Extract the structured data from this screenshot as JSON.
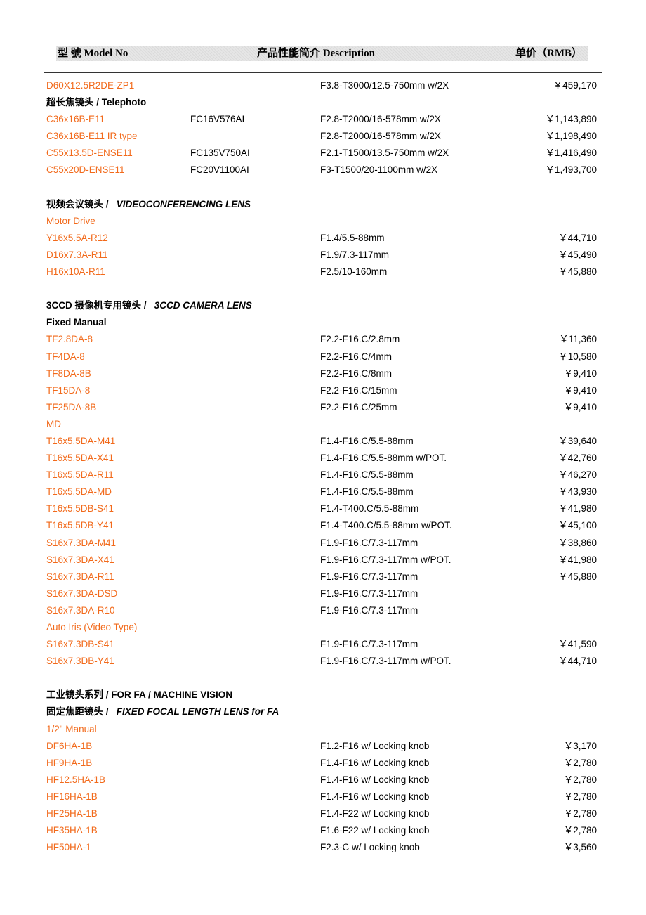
{
  "header": {
    "model_label": "型   號 Model No",
    "desc_label": "产品性能简介 Description",
    "price_label": "单价（RMB）"
  },
  "colors": {
    "model_text": "#f26a1b",
    "body_text": "#000000"
  },
  "rows": [
    {
      "type": "item",
      "model": "D60X12.5R2DE-ZP1",
      "alt": "",
      "desc": "F3.8-T3000/12.5-750mm w/2X",
      "price": "￥459,170"
    },
    {
      "type": "section",
      "cn": "超长焦镜头",
      "en": "/ Telephoto",
      "en_italic": false
    },
    {
      "type": "item",
      "model": "C36x16B-E11",
      "alt": "FC16V576AI",
      "desc": "F2.8-T2000/16-578mm w/2X",
      "price": "￥1,143,890"
    },
    {
      "type": "item",
      "model": "C36x16B-E11 IR type",
      "alt": "",
      "desc": "F2.8-T2000/16-578mm w/2X",
      "price": "￥1,198,490"
    },
    {
      "type": "item",
      "model": "C55x13.5D-ENSE11",
      "alt": "FC135V750AI",
      "desc": "F2.1-T1500/13.5-750mm w/2X",
      "price": "￥1,416,490"
    },
    {
      "type": "item",
      "model": "C55x20D-ENSE11",
      "alt": "FC20V1100AI",
      "desc": "F3-T1500/20-1100mm w/2X",
      "price": "￥1,493,700"
    },
    {
      "type": "gap"
    },
    {
      "type": "section",
      "cn": "视频会议镜头 /",
      "en": "VIDEOCONFERENCING LENS",
      "en_italic": true
    },
    {
      "type": "subsection",
      "label": "Motor Drive",
      "orange": true
    },
    {
      "type": "item",
      "model": "Y16x5.5A-R12",
      "alt": "",
      "desc": "F1.4/5.5-88mm",
      "price": "￥44,710"
    },
    {
      "type": "item",
      "model": "D16x7.3A-R11",
      "alt": "",
      "desc": "F1.9/7.3-117mm",
      "price": "￥45,490"
    },
    {
      "type": "item",
      "model": "H16x10A-R11",
      "alt": "",
      "desc": "F2.5/10-160mm",
      "price": "￥45,880"
    },
    {
      "type": "gap"
    },
    {
      "type": "section",
      "cn": "3CCD 摄像机专用镜头 /",
      "en": "3CCD CAMERA LENS",
      "en_italic": true
    },
    {
      "type": "subsection",
      "label": "Fixed Manual",
      "orange": false
    },
    {
      "type": "item",
      "model": "TF2.8DA-8",
      "alt": "",
      "desc": "F2.2-F16.C/2.8mm",
      "price": "￥11,360"
    },
    {
      "type": "item",
      "model": "TF4DA-8",
      "alt": "",
      "desc": "F2.2-F16.C/4mm",
      "price": "￥10,580"
    },
    {
      "type": "item",
      "model": "TF8DA-8B",
      "alt": "",
      "desc": "F2.2-F16.C/8mm",
      "price": "￥9,410"
    },
    {
      "type": "item",
      "model": "TF15DA-8",
      "alt": "",
      "desc": "F2.2-F16.C/15mm",
      "price": "￥9,410"
    },
    {
      "type": "item",
      "model": "TF25DA-8B",
      "alt": "",
      "desc": "F2.2-F16.C/25mm",
      "price": "￥9,410"
    },
    {
      "type": "subsection",
      "label": "MD",
      "orange": true
    },
    {
      "type": "item",
      "model": "T16x5.5DA-M41",
      "alt": "",
      "desc": "F1.4-F16.C/5.5-88mm",
      "price": "￥39,640"
    },
    {
      "type": "item",
      "model": "T16x5.5DA-X41",
      "alt": "",
      "desc": "F1.4-F16.C/5.5-88mm w/POT.",
      "price": "￥42,760"
    },
    {
      "type": "item",
      "model": "T16x5.5DA-R11",
      "alt": "",
      "desc": "F1.4-F16.C/5.5-88mm",
      "price": "￥46,270"
    },
    {
      "type": "item",
      "model": "T16x5.5DA-MD",
      "alt": "",
      "desc": "F1.4-F16.C/5.5-88mm",
      "price": "￥43,930"
    },
    {
      "type": "item",
      "model": "T16x5.5DB-S41",
      "alt": "",
      "desc": "F1.4-T400.C/5.5-88mm",
      "price": "￥41,980"
    },
    {
      "type": "item",
      "model": "T16x5.5DB-Y41",
      "alt": "",
      "desc": "F1.4-T400.C/5.5-88mm w/POT.",
      "price": "￥45,100"
    },
    {
      "type": "item",
      "model": "S16x7.3DA-M41",
      "alt": "",
      "desc": "F1.9-F16.C/7.3-117mm",
      "price": "￥38,860"
    },
    {
      "type": "item",
      "model": "S16x7.3DA-X41",
      "alt": "",
      "desc": "F1.9-F16.C/7.3-117mm w/POT.",
      "price": "￥41,980"
    },
    {
      "type": "item",
      "model": "S16x7.3DA-R11",
      "alt": "",
      "desc": "F1.9-F16.C/7.3-117mm",
      "price": "￥45,880"
    },
    {
      "type": "item",
      "model": "S16x7.3DA-DSD",
      "alt": "",
      "desc": "F1.9-F16.C/7.3-117mm",
      "price": ""
    },
    {
      "type": "item",
      "model": "S16x7.3DA-R10",
      "alt": "",
      "desc": "F1.9-F16.C/7.3-117mm",
      "price": ""
    },
    {
      "type": "subsection",
      "label": "Auto Iris (Video Type)",
      "orange": true
    },
    {
      "type": "item",
      "model": "S16x7.3DB-S41",
      "alt": "",
      "desc": "F1.9-F16.C/7.3-117mm",
      "price": "￥41,590"
    },
    {
      "type": "item",
      "model": "S16x7.3DB-Y41",
      "alt": "",
      "desc": "F1.9-F16.C/7.3-117mm w/POT.",
      "price": "￥44,710"
    },
    {
      "type": "gap"
    },
    {
      "type": "section",
      "cn": "工业镜头系列",
      "en": "/ FOR FA / MACHINE VISION",
      "en_italic": false
    },
    {
      "type": "section",
      "cn": "固定焦距镜头 /",
      "en": "FIXED FOCAL LENGTH LENS for FA",
      "en_italic": true
    },
    {
      "type": "subsection",
      "label": "1/2\" Manual",
      "orange": true
    },
    {
      "type": "item",
      "model": "DF6HA-1B",
      "alt": "",
      "desc": "F1.2-F16 w/ Locking knob",
      "price": "￥3,170"
    },
    {
      "type": "item",
      "model": "HF9HA-1B",
      "alt": "",
      "desc": "F1.4-F16 w/ Locking knob",
      "price": "￥2,780"
    },
    {
      "type": "item",
      "model": "HF12.5HA-1B",
      "alt": "",
      "desc": "F1.4-F16 w/ Locking knob",
      "price": "￥2,780"
    },
    {
      "type": "item",
      "model": "HF16HA-1B",
      "alt": "",
      "desc": "F1.4-F16 w/ Locking knob",
      "price": "￥2,780"
    },
    {
      "type": "item",
      "model": "HF25HA-1B",
      "alt": "",
      "desc": "F1.4-F22 w/ Locking knob",
      "price": "￥2,780"
    },
    {
      "type": "item",
      "model": "HF35HA-1B",
      "alt": "",
      "desc": "F1.6-F22 w/ Locking knob",
      "price": "￥2,780"
    },
    {
      "type": "item",
      "model": "HF50HA-1",
      "alt": "",
      "desc": "F2.3-C w/ Locking knob",
      "price": "￥3,560"
    }
  ]
}
